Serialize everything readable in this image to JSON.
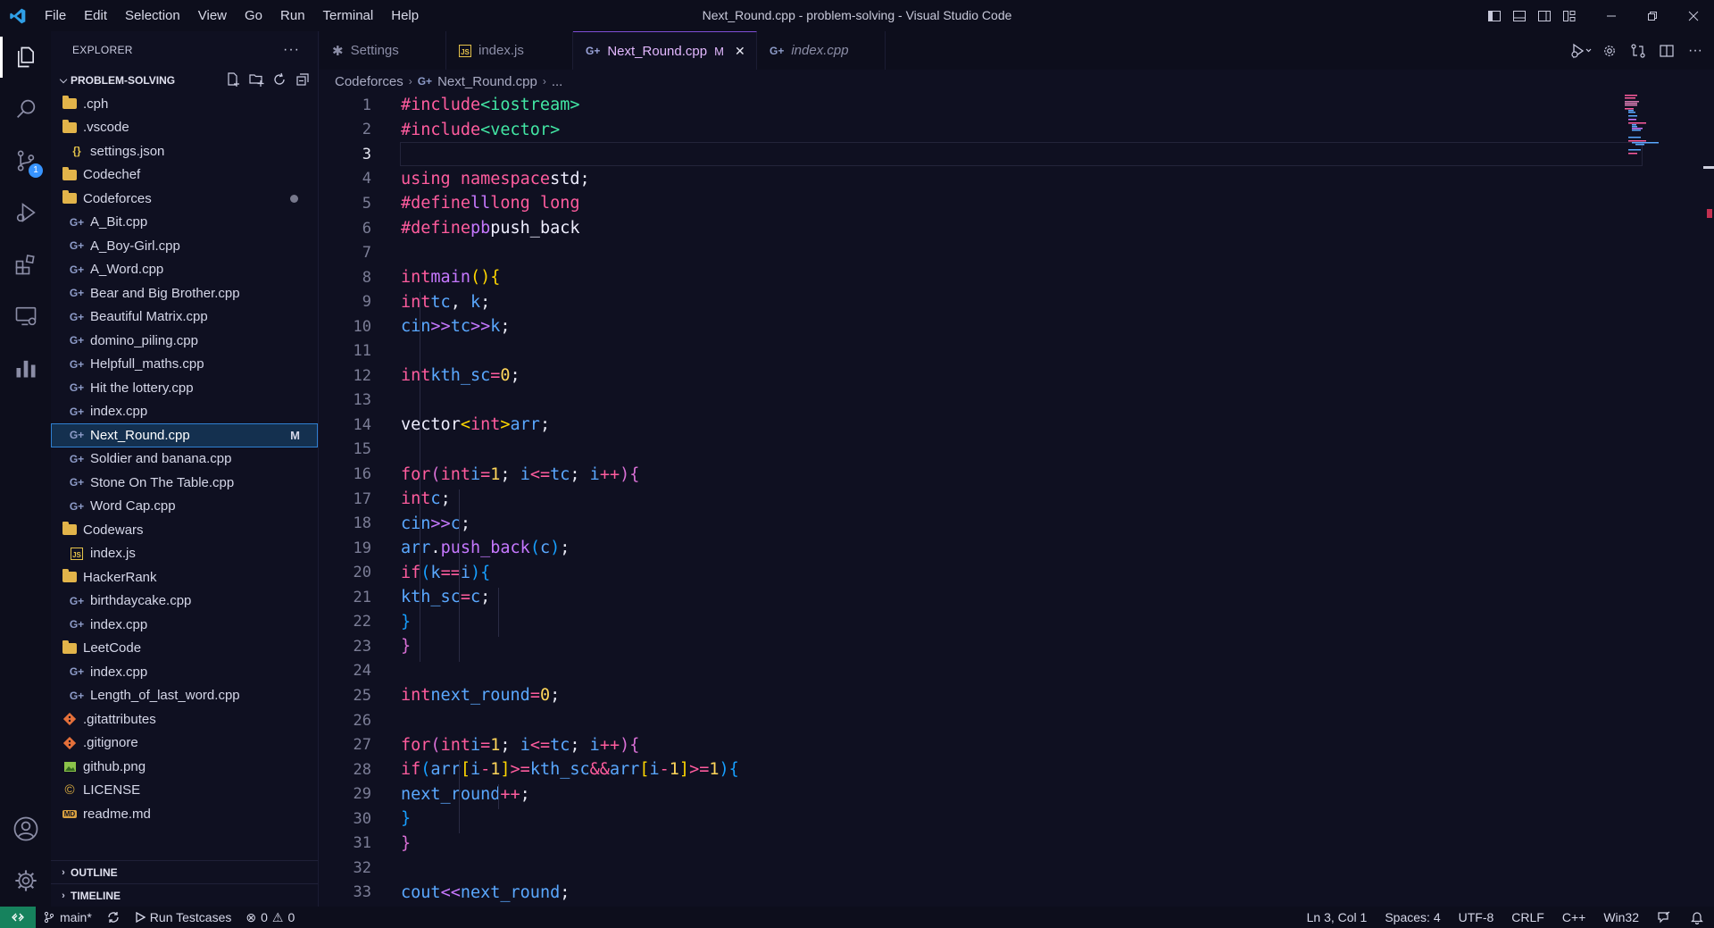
{
  "titlebar": {
    "menu": [
      "File",
      "Edit",
      "Selection",
      "View",
      "Go",
      "Run",
      "Terminal",
      "Help"
    ],
    "window_title": "Next_Round.cpp - problem-solving - Visual Studio Code"
  },
  "activity": {
    "scm_badge": "1"
  },
  "sidebar": {
    "header": "EXPLORER",
    "more": "···",
    "root": "PROBLEM-SOLVING",
    "outline": "OUTLINE",
    "timeline": "TIMELINE",
    "items": [
      {
        "label": ".cph",
        "kind": "folder",
        "depth": 0
      },
      {
        "label": ".vscode",
        "kind": "folder",
        "depth": 0
      },
      {
        "label": "settings.json",
        "kind": "json",
        "depth": 1
      },
      {
        "label": "Codechef",
        "kind": "folder",
        "depth": 0
      },
      {
        "label": "Codeforces",
        "kind": "folder",
        "depth": 0,
        "dot": true
      },
      {
        "label": "A_Bit.cpp",
        "kind": "cpp",
        "depth": 1
      },
      {
        "label": "A_Boy-Girl.cpp",
        "kind": "cpp",
        "depth": 1
      },
      {
        "label": "A_Word.cpp",
        "kind": "cpp",
        "depth": 1
      },
      {
        "label": "Bear and Big Brother.cpp",
        "kind": "cpp",
        "depth": 1
      },
      {
        "label": "Beautiful Matrix.cpp",
        "kind": "cpp",
        "depth": 1
      },
      {
        "label": "domino_piling.cpp",
        "kind": "cpp",
        "depth": 1
      },
      {
        "label": "Helpfull_maths.cpp",
        "kind": "cpp",
        "depth": 1
      },
      {
        "label": "Hit the lottery.cpp",
        "kind": "cpp",
        "depth": 1
      },
      {
        "label": "index.cpp",
        "kind": "cpp",
        "depth": 1
      },
      {
        "label": "Next_Round.cpp",
        "kind": "cpp",
        "depth": 1,
        "selected": true,
        "status": "M"
      },
      {
        "label": "Soldier and banana.cpp",
        "kind": "cpp",
        "depth": 1
      },
      {
        "label": "Stone On The Table.cpp",
        "kind": "cpp",
        "depth": 1
      },
      {
        "label": "Word Cap.cpp",
        "kind": "cpp",
        "depth": 1
      },
      {
        "label": "Codewars",
        "kind": "folder",
        "depth": 0
      },
      {
        "label": "index.js",
        "kind": "js",
        "depth": 1
      },
      {
        "label": "HackerRank",
        "kind": "folder",
        "depth": 0
      },
      {
        "label": "birthdaycake.cpp",
        "kind": "cpp",
        "depth": 1
      },
      {
        "label": "index.cpp",
        "kind": "cpp",
        "depth": 1
      },
      {
        "label": "LeetCode",
        "kind": "folder",
        "depth": 0
      },
      {
        "label": "index.cpp",
        "kind": "cpp",
        "depth": 1
      },
      {
        "label": "Length_of_last_word.cpp",
        "kind": "cpp",
        "depth": 1
      },
      {
        "label": ".gitattributes",
        "kind": "git",
        "depth": 0
      },
      {
        "label": ".gitignore",
        "kind": "git",
        "depth": 0
      },
      {
        "label": "github.png",
        "kind": "png",
        "depth": 0
      },
      {
        "label": "LICENSE",
        "kind": "license",
        "depth": 0
      },
      {
        "label": "readme.md",
        "kind": "md",
        "depth": 0
      }
    ]
  },
  "tabs": [
    {
      "label": "Settings",
      "icon": "settings-icon"
    },
    {
      "label": "index.js",
      "icon": "js-icon"
    },
    {
      "label": "Next_Round.cpp",
      "icon": "cpp-icon",
      "active": true,
      "status": "M"
    },
    {
      "label": "index.cpp",
      "icon": "cpp-icon",
      "italic": true
    }
  ],
  "breadcrumb": {
    "folder": "Codeforces",
    "file": "Next_Round.cpp",
    "more": "..."
  },
  "editor": {
    "current_line": 3,
    "line_numbers": [
      "1",
      "2",
      "3",
      "4",
      "5",
      "6",
      "7",
      "8",
      "9",
      "10",
      "11",
      "12",
      "13",
      "14",
      "15",
      "16",
      "17",
      "18",
      "19",
      "20",
      "21",
      "22",
      "23",
      "24",
      "25",
      "26",
      "27",
      "28",
      "29",
      "30",
      "31",
      "32",
      "33"
    ]
  },
  "statusbar": {
    "branch": "main*",
    "run": "Run Testcases",
    "errors": "0",
    "warnings": "0",
    "position": "Ln 3, Col 1",
    "spaces": "Spaces: 4",
    "encoding": "UTF-8",
    "eol": "CRLF",
    "language": "C++",
    "platform": "Win32"
  },
  "colors": {
    "accent": "#7f4fd6",
    "selection": "#14304f",
    "remote": "#16825d"
  }
}
